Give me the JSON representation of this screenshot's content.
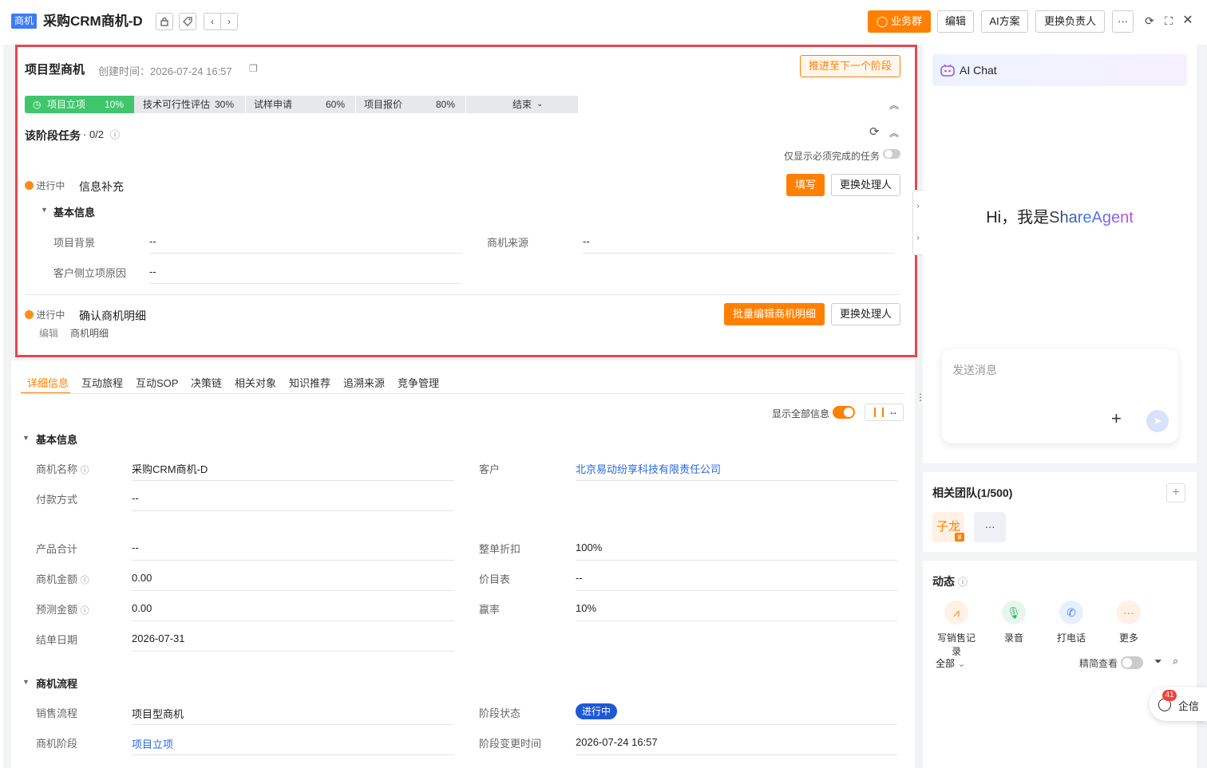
{
  "header": {
    "object_badge": "商机",
    "title": "采购CRM商机-D",
    "lock_icon": "lock-icon",
    "tag_icon": "tag-icon",
    "prev_icon": "‹",
    "next_icon": "›",
    "btn_group": "业务群",
    "btn_edit": "编辑",
    "btn_ai": "AI方案",
    "btn_owner": "更换负责人",
    "btn_more": "···"
  },
  "stage_card": {
    "title": "项目型商机",
    "created": "创建时间：2026-07-24 16:57",
    "advance_button": "推进至下一个阶段",
    "stages": [
      {
        "name": "项目立项",
        "pct": "10%"
      },
      {
        "name": "技术可行性评估",
        "pct": "30%"
      },
      {
        "name": "试样申请",
        "pct": "60%"
      },
      {
        "name": "项目报价",
        "pct": "80%"
      },
      {
        "name": "结束",
        "pct": ""
      }
    ],
    "tasks_title": "该阶段任务",
    "tasks_count": "· 0/2",
    "only_required": "仅显示必须完成的任务",
    "task1": {
      "status": "进行中",
      "name": "信息补充",
      "fill_button": "填写",
      "change_button": "更换处理人",
      "section": "基本信息",
      "fields": [
        {
          "label": "项目背景",
          "value": "--"
        },
        {
          "label": "商机来源",
          "value": "--"
        },
        {
          "label": "客户侧立项原因",
          "value": "--"
        }
      ]
    },
    "task2": {
      "status": "进行中",
      "name": "确认商机明细",
      "batch_button": "批量编辑商机明细",
      "change_button": "更换处理人",
      "sub_action": "编辑",
      "sub_object": "商机明细"
    }
  },
  "detail": {
    "tabs": [
      "详细信息",
      "互动旅程",
      "互动SOP",
      "决策链",
      "相关对象",
      "知识推荐",
      "追溯来源",
      "竞争管理"
    ],
    "show_all": "显示全部信息",
    "basic_section": "基本信息",
    "basic_fields": {
      "name_label": "商机名称",
      "name_value": "采购CRM商机-D",
      "customer_label": "客户",
      "customer_value": "北京易动纷享科技有限责任公司",
      "payment_label": "付款方式",
      "payment_value": "--",
      "product_total_label": "产品合计",
      "product_total_value": "--",
      "discount_label": "整单折扣",
      "discount_value": "100%",
      "amount_label": "商机金额",
      "amount_value": "0.00",
      "pricebook_label": "价目表",
      "pricebook_value": "--",
      "forecast_label": "预测金额",
      "forecast_value": "0.00",
      "winrate_label": "赢率",
      "winrate_value": "10%",
      "close_date_label": "结单日期",
      "close_date_value": "2026-07-31"
    },
    "flow_section": "商机流程",
    "flow_fields": {
      "process_label": "销售流程",
      "process_value": "项目型商机",
      "stage_status_label": "阶段状态",
      "stage_status_value": "进行中",
      "stage_label": "商机阶段",
      "stage_value": "项目立项",
      "stage_change_label": "阶段变更时间",
      "stage_change_value": "2026-07-24 16:57"
    }
  },
  "ai_chat": {
    "title": "AI Chat",
    "greeting_prefix": "Hi，我是",
    "greeting_name": "ShareAgent",
    "input_placeholder": "发送消息"
  },
  "team": {
    "title": "相关团队(1/500)",
    "member": "子龙",
    "more": "···"
  },
  "feed": {
    "title": "动态",
    "actions": [
      "写销售记录",
      "录音",
      "打电话",
      "更多"
    ],
    "filter": "全部",
    "compact": "精简查看"
  },
  "qixin": {
    "label": "企信",
    "count": "41"
  },
  "colors": {
    "accent": "#ff8000",
    "stage_active": "#3fc56b",
    "link": "#2a68d8",
    "highlight_border": "#e8464f"
  }
}
